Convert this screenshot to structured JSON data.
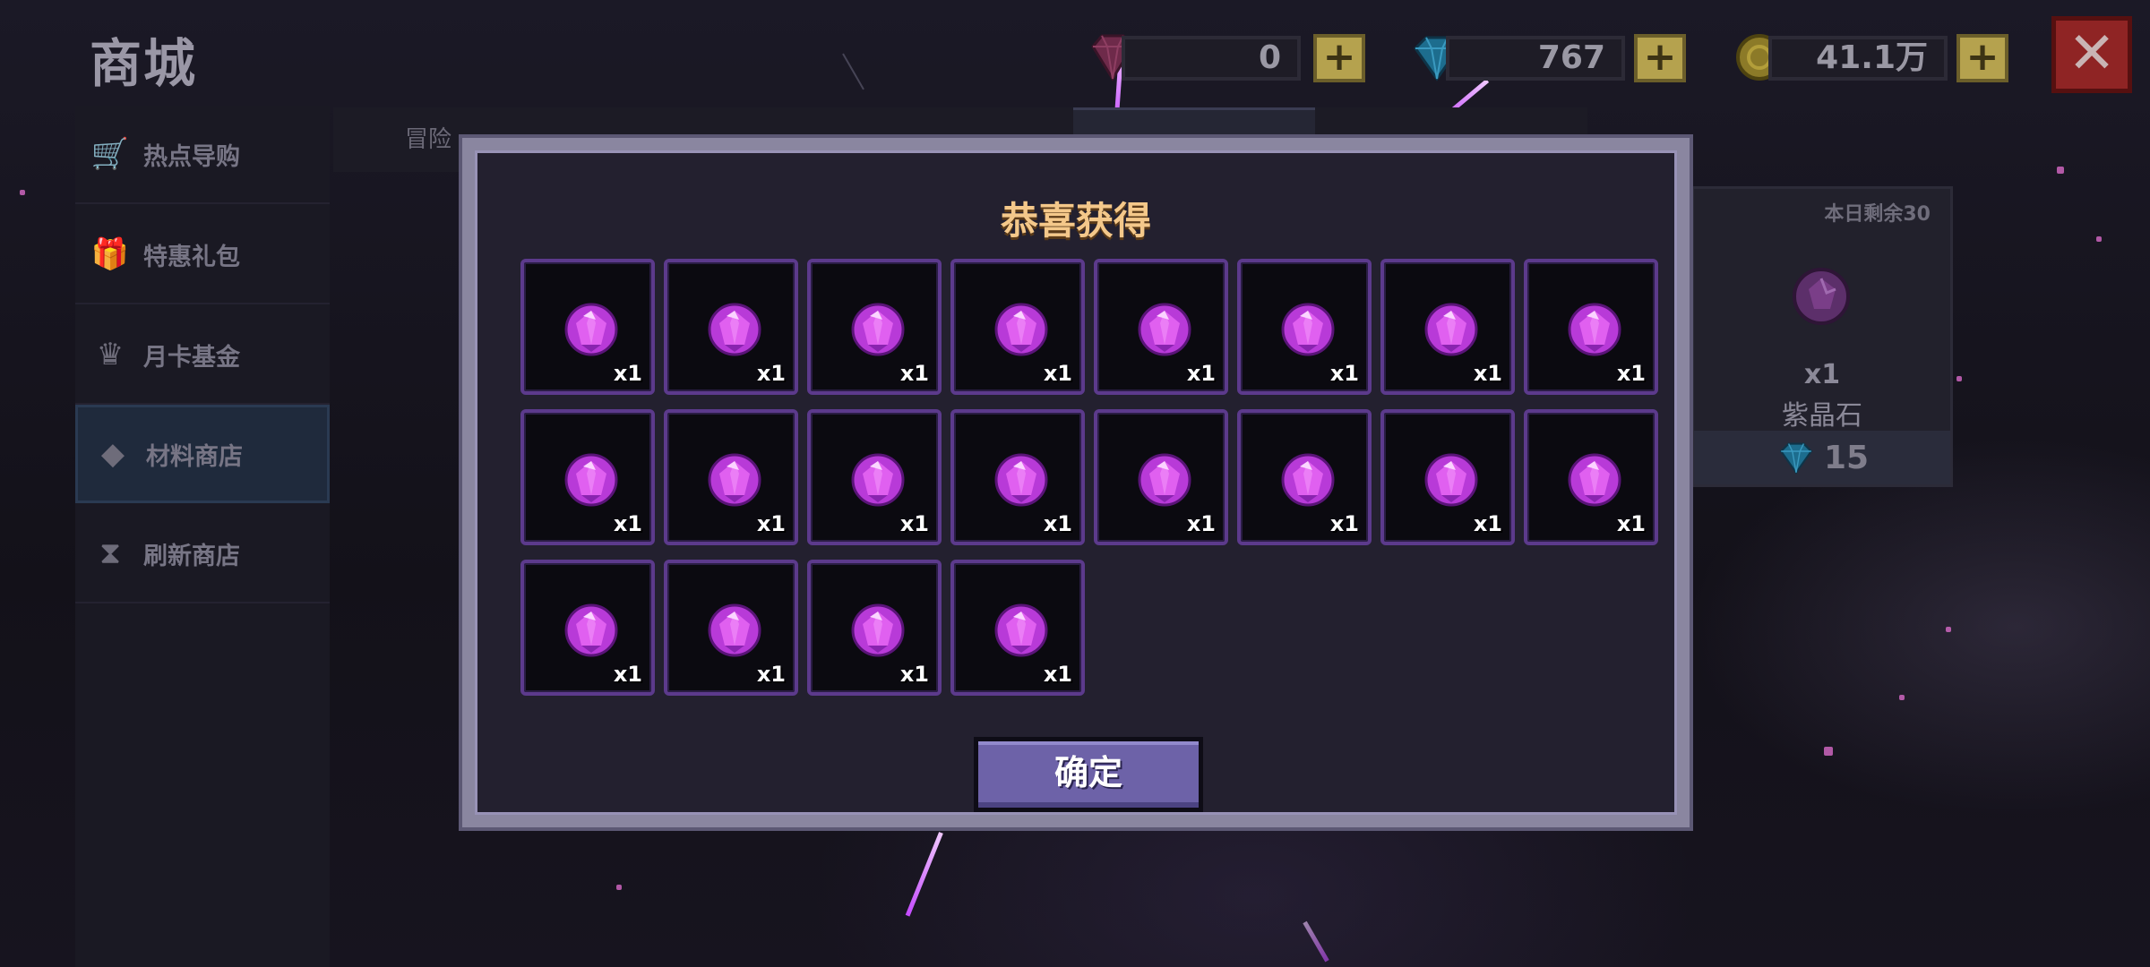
{
  "header": {
    "title": "商城"
  },
  "currencies": [
    {
      "icon": "red-gem-icon",
      "value": "0"
    },
    {
      "icon": "blue-diamond-icon",
      "value": "767"
    },
    {
      "icon": "gold-coin-icon",
      "value": "41.1万"
    }
  ],
  "sidebar": {
    "items": [
      {
        "icon": "cart-icon",
        "label": "热点导购"
      },
      {
        "icon": "gift-icon",
        "label": "特惠礼包"
      },
      {
        "icon": "card-icon",
        "label": "月卡基金"
      },
      {
        "icon": "gem-icon",
        "label": "材料商店",
        "active": true
      },
      {
        "icon": "hourglass-icon",
        "label": "刷新商店"
      }
    ]
  },
  "tabs": [
    {
      "label": "冒险"
    }
  ],
  "product_card": {
    "remaining": "本日剩余30",
    "quantity": "x1",
    "name": "紫晶石",
    "price": "15",
    "price_icon": "blue-diamond-icon"
  },
  "modal": {
    "title": "恭喜获得",
    "confirm_label": "确定",
    "reward_count_label": "x1",
    "rewards": [
      {
        "count": "x1"
      },
      {
        "count": "x1"
      },
      {
        "count": "x1"
      },
      {
        "count": "x1"
      },
      {
        "count": "x1"
      },
      {
        "count": "x1"
      },
      {
        "count": "x1"
      },
      {
        "count": "x1"
      },
      {
        "count": "x1"
      },
      {
        "count": "x1"
      },
      {
        "count": "x1"
      },
      {
        "count": "x1"
      },
      {
        "count": "x1"
      },
      {
        "count": "x1"
      },
      {
        "count": "x1"
      },
      {
        "count": "x1"
      },
      {
        "count": "x1"
      },
      {
        "count": "x1"
      },
      {
        "count": "x1"
      },
      {
        "count": "x1"
      }
    ]
  },
  "colors": {
    "gem_primary": "#e060f0",
    "slot_border": "#5c3a8c",
    "modal_title": "#f4c88a",
    "confirm_button": "#6d62a8"
  }
}
